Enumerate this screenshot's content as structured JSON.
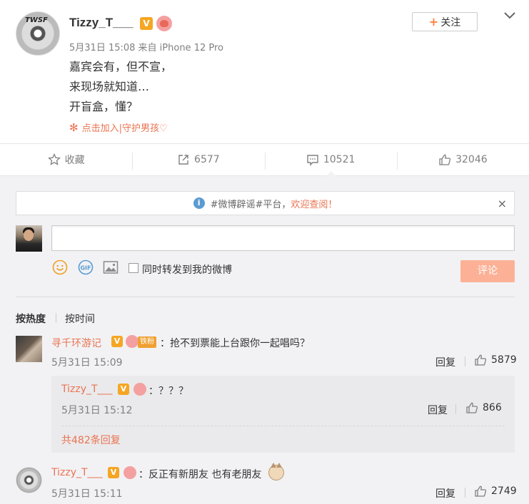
{
  "post": {
    "username": "Tizzy_T___",
    "verified_badge": "V",
    "meta": "5月31日 15:08 来自 iPhone 12 Pro",
    "content_lines": [
      "嘉宾会有，但不宣，",
      "来现场就知道…",
      "开盲盒，懂？"
    ],
    "super_topic_link": "点击加入|守护男孩♡",
    "follow_label": "关注",
    "follow_plus": "+",
    "avatar_text": "TWSF"
  },
  "actions": {
    "favorite_label": "收藏",
    "repost_count": "6577",
    "comment_count": "10521",
    "like_count": "32046"
  },
  "comment_box": {
    "notice_prefix": "#微博辟谣#平台，",
    "notice_link": "欢迎查阅！",
    "notice_close": "×",
    "input_placeholder": "",
    "repost_checkbox_label": "同时转发到我的微博",
    "submit_label": "评论"
  },
  "sort": {
    "hot_label": "按热度",
    "time_label": "按时间"
  },
  "comments": [
    {
      "name": "寻千环游记",
      "fan_badge": "铁粉",
      "text": "：抢不到票能上台跟你一起唱吗？",
      "time": "5月31日 15:09",
      "reply_label": "回复",
      "likes": "5879"
    },
    {
      "name": "Tizzy_T___",
      "text": "：？？？",
      "time": "5月31日 15:12",
      "reply_label": "回复",
      "likes": "866"
    },
    {
      "name": "Tizzy_T___",
      "text": "：反正有新朋友 也有老朋友",
      "time": "5月31日 15:11",
      "reply_label": "回复",
      "likes": "2749"
    }
  ],
  "reply_more": "共482条回复",
  "colors": {
    "accent_orange": "#eb7350",
    "submit_disabled": "#fcb196",
    "comment_bg": "#f2f2f5",
    "verified_gold": "#f5a623"
  }
}
